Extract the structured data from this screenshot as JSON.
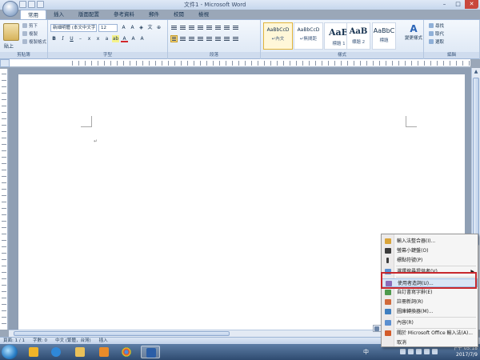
{
  "window": {
    "title": "文件1 - Microsoft Word",
    "controls": {
      "minimize": "–",
      "maximize": "□",
      "close": "✕"
    }
  },
  "tabs": [
    "常用",
    "插入",
    "版面配置",
    "參考資料",
    "郵件",
    "校閱",
    "檢視"
  ],
  "ribbon": {
    "clipboard": {
      "paste": "貼上",
      "cut": "剪下",
      "copy": "複製",
      "format_painter": "複製格式",
      "group_label": "剪貼簿"
    },
    "font": {
      "font_name": "新細明體 (本文中文字",
      "font_size": "12",
      "group_label": "字型"
    },
    "paragraph": {
      "group_label": "段落"
    },
    "styles": {
      "items": [
        {
          "sample": "AaBbCcD",
          "name": "↵內文"
        },
        {
          "sample": "AaBbCcD",
          "name": "↵無間距"
        },
        {
          "sample": "AaB",
          "name": "標題 1"
        },
        {
          "sample": "AaB",
          "name": "標題 2"
        },
        {
          "sample": "AaBbC",
          "name": "標題"
        }
      ],
      "change_styles": "變更樣式",
      "group_label": "樣式"
    },
    "editing": {
      "find": "尋找",
      "replace": "取代",
      "select": "選取",
      "group_label": "編輯"
    }
  },
  "document": {
    "paragraph_mark": "↵"
  },
  "status": {
    "page": "頁面: 1 / 1",
    "words": "字數: 0",
    "language": "中文 (繁體，台灣)",
    "mode": "插入"
  },
  "taskbar": {
    "language_indicator": "中",
    "time": "下午 05:18",
    "date": "2017/7/9"
  },
  "context_menu": {
    "items": [
      {
        "label": "輸入法整合器(I)...",
        "color": "#d9a43a"
      },
      {
        "label": "螢幕小鍵盤(O)",
        "color": "#3c3c3c"
      },
      {
        "label": "標點符號(P)",
        "color": "#3c3c3c"
      },
      {
        "label": "選擇搜尋提供者(V)",
        "color": "#5a8fd0",
        "submenu": "▶"
      },
      {
        "label": "使用者造詞(U)...",
        "color": "#8a6bb8"
      },
      {
        "label": "自訂書寫字辭(E)",
        "color": "#4d9a4d"
      },
      {
        "label": "註冊新詞(R)",
        "color": "#d06a3a"
      },
      {
        "label": "圖庫轉換器(M)...",
        "color": "#3f7fc0"
      },
      {
        "label": "內容(R)",
        "color": "#5a8fd0"
      },
      {
        "label": "關於 Microsoft Office 輸入法(A)...",
        "color": "#d35c2a"
      },
      {
        "label": "取消",
        "color": ""
      }
    ]
  }
}
